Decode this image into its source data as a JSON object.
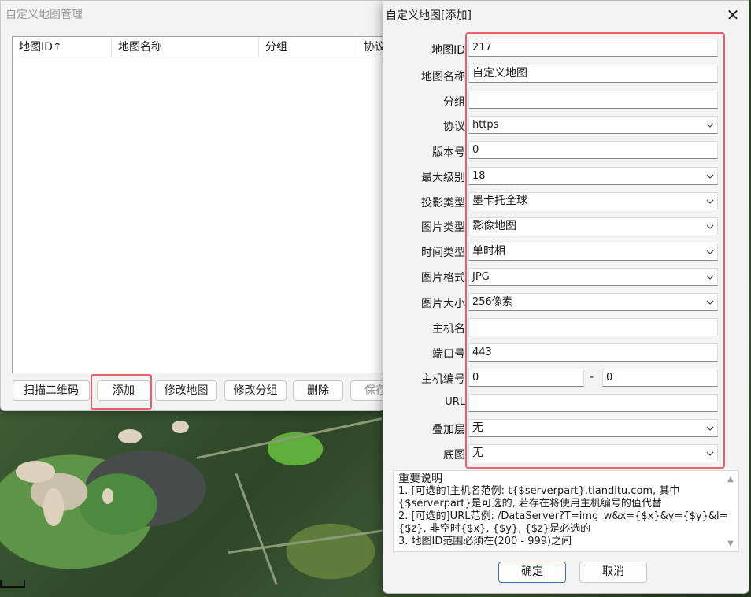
{
  "manager": {
    "title": "自定义地图管理",
    "columns": [
      "地图ID↑",
      "地图名称",
      "分组",
      "协议"
    ],
    "buttons": {
      "scan": "扫描二维码",
      "add": "添加",
      "edit_map": "修改地图",
      "edit_group": "修改分组",
      "delete": "删除",
      "save": "保存"
    }
  },
  "dialog": {
    "title": "自定义地图[添加]",
    "close_glyph": "✕",
    "labels": {
      "map_id": "地图ID",
      "map_name": "地图名称",
      "group": "分组",
      "protocol": "协议",
      "version": "版本号",
      "max_level": "最大级别",
      "projection": "投影类型",
      "image_type": "图片类型",
      "time_type": "时间类型",
      "image_format": "图片格式",
      "image_size": "图片大小",
      "host": "主机名",
      "port": "端口号",
      "host_number": "主机编号",
      "url": "URL",
      "overlay": "叠加层",
      "base_map": "底图"
    },
    "values": {
      "map_id": "217",
      "map_name": "自定义地图",
      "group": "",
      "protocol": "https",
      "version": "0",
      "max_level": "18",
      "projection": "墨卡托全球",
      "image_type": "影像地图",
      "time_type": "单时相",
      "image_format": "JPG",
      "image_size": "256像素",
      "host": "",
      "port": "443",
      "host_number_from": "0",
      "host_number_dash": "-",
      "host_number_to": "0",
      "url": "",
      "overlay": "无",
      "base_map": "无"
    },
    "notes": [
      "重要说明",
      "1. [可选的]主机名范例: t{$serverpart}.tianditu.com, 其中",
      "{$serverpart}是可选的, 若存在将使用主机编号的值代替",
      "2. [可选的]URL范例: /DataServer?T=img_w&x={$x}&y={$y}&l=",
      "{$z}, 非空时{$x}, {$y}, {$z}是必选的",
      "3. 地图ID范围必须在(200 - 999)之间"
    ],
    "buttons": {
      "ok": "确定",
      "cancel": "取消"
    }
  },
  "colors": {
    "highlight": "#e8606c",
    "primary_border": "#3c6fb6"
  }
}
